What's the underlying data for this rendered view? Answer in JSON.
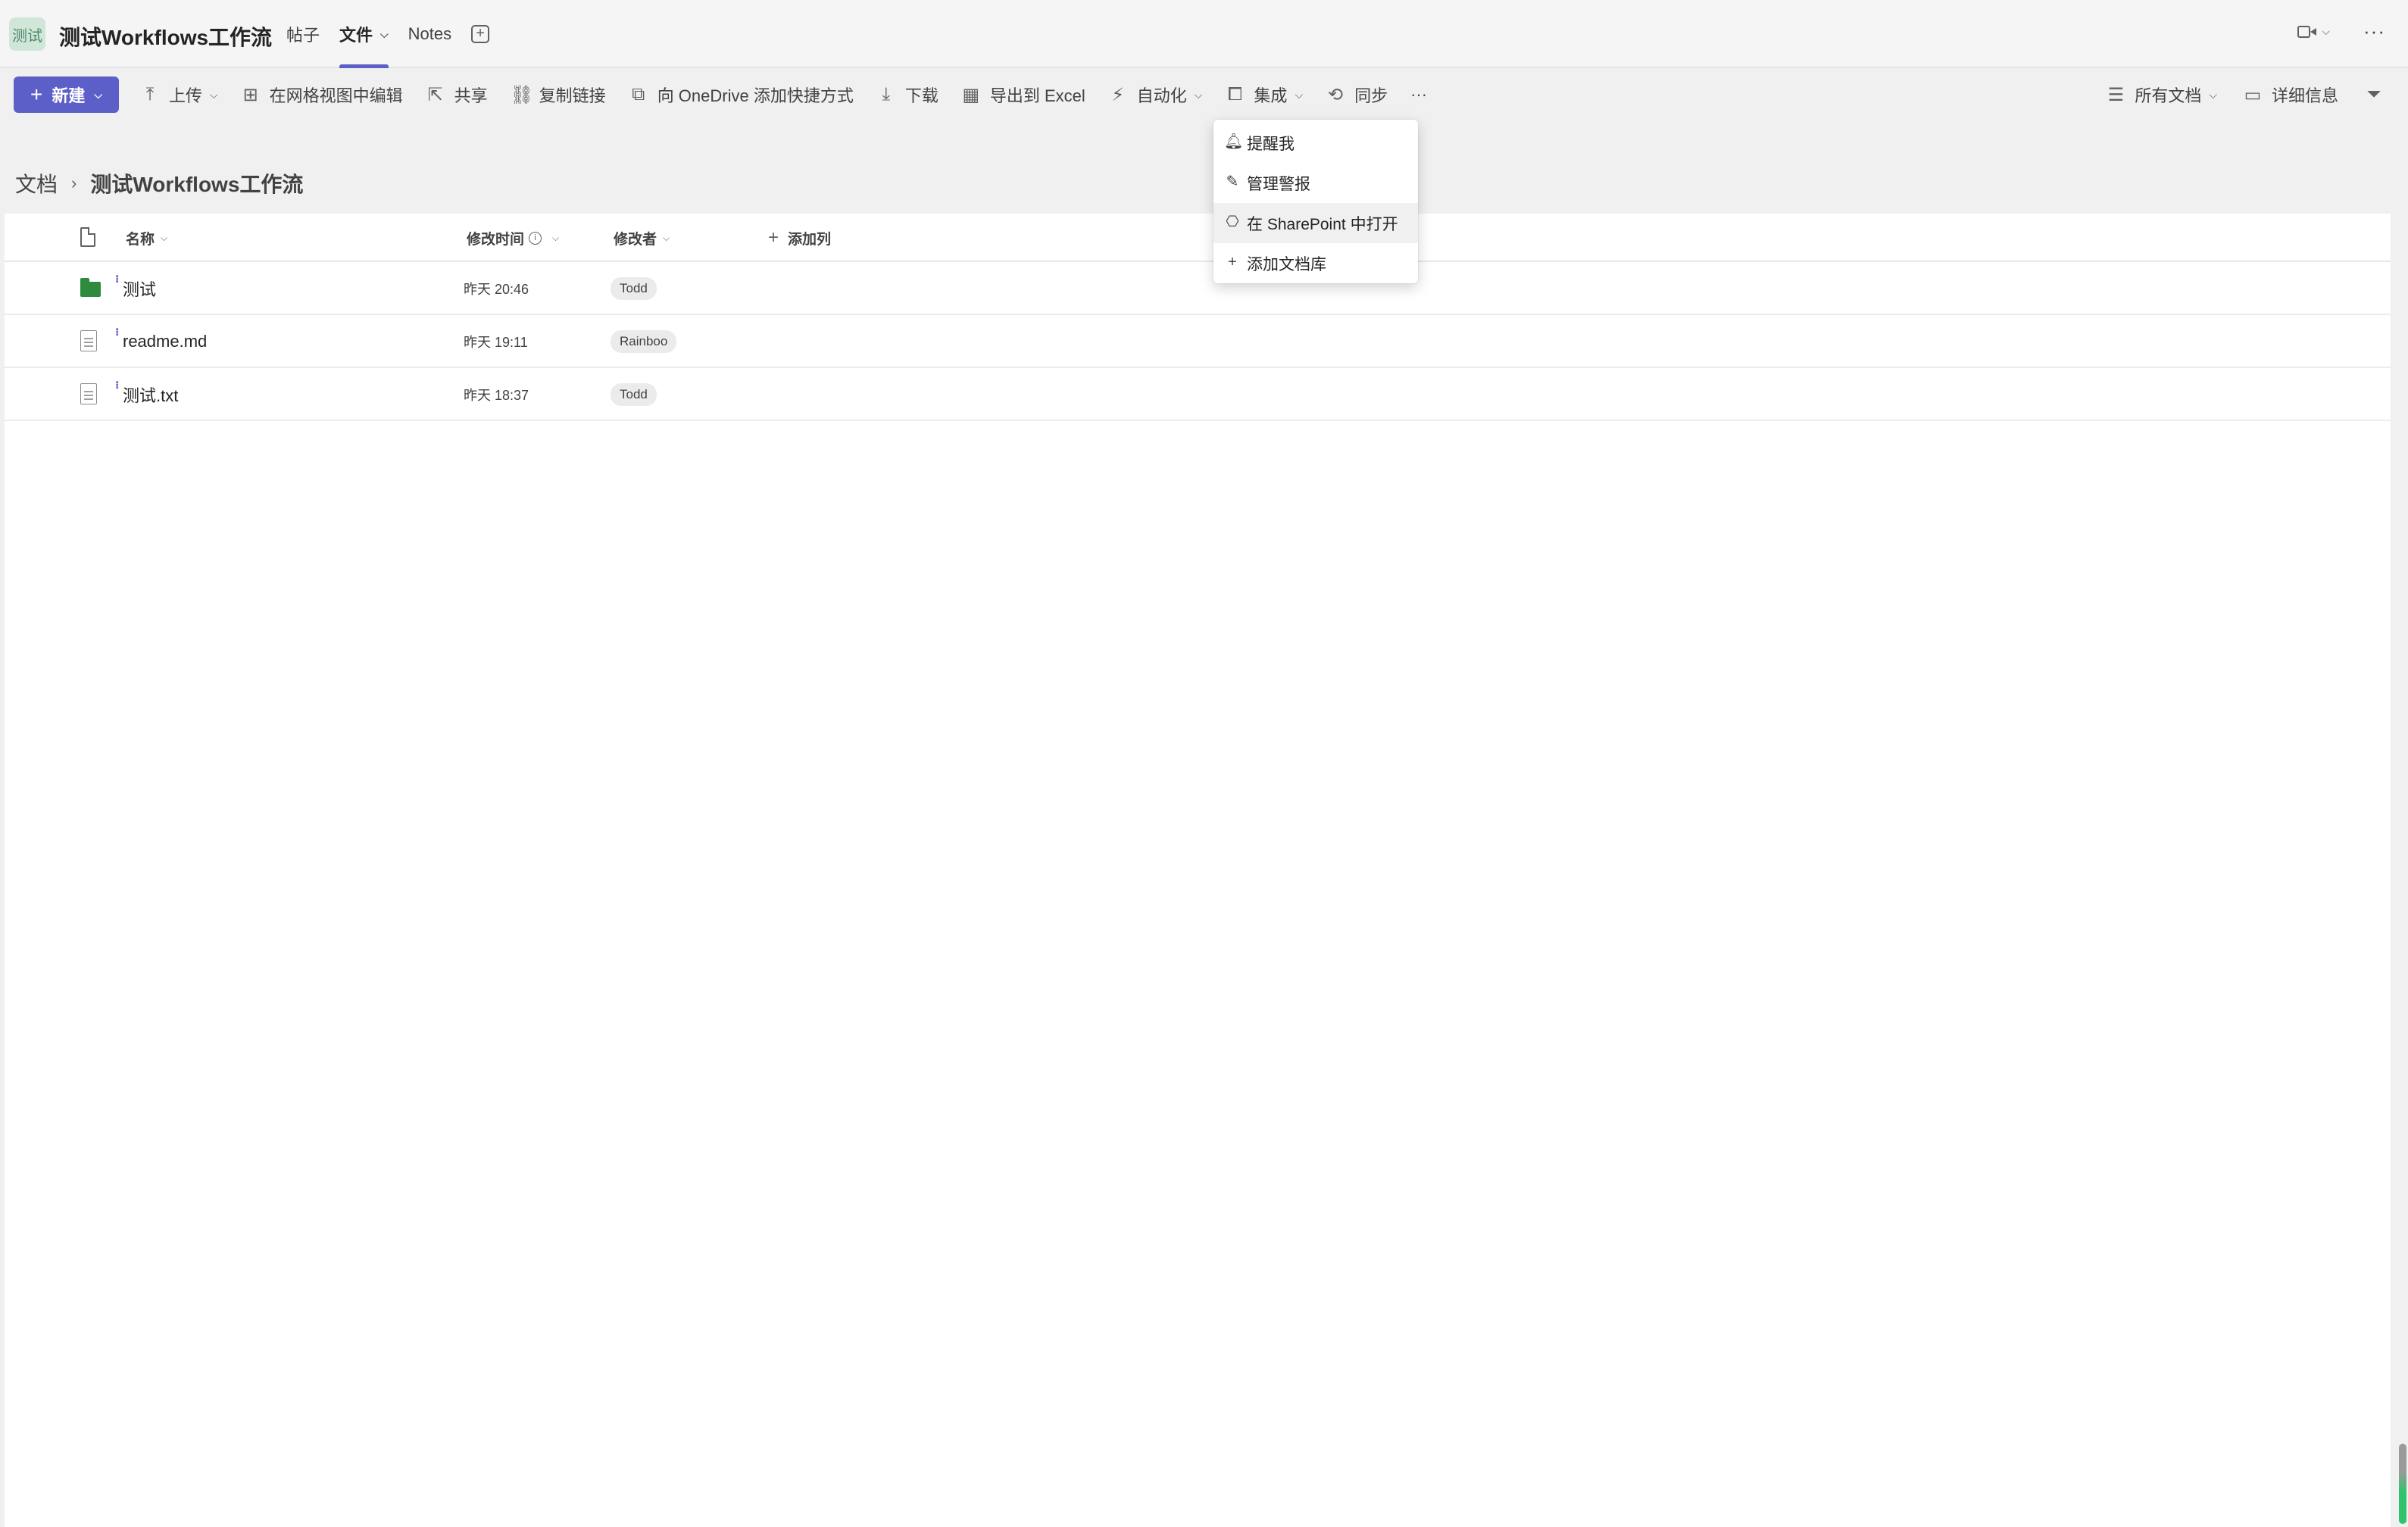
{
  "header": {
    "avatar_text": "测试",
    "title": "测试Workflows工作流",
    "tabs": [
      {
        "label": "帖子",
        "active": false
      },
      {
        "label": "文件",
        "active": true
      },
      {
        "label": "Notes",
        "active": false
      }
    ],
    "icons": [
      "add-tab-icon",
      "video-icon",
      "chevron-down-icon",
      "more-icon"
    ]
  },
  "toolbar": {
    "new_label": "新建",
    "upload_label": "上传",
    "grid_edit_label": "在网格视图中编辑",
    "share_label": "共享",
    "copy_link_label": "复制链接",
    "onedrive_label": "向 OneDrive 添加快捷方式",
    "download_label": "下载",
    "export_label": "导出到 Excel",
    "automate_label": "自动化",
    "integrate_label": "集成",
    "sync_label": "同步",
    "more_label": "···",
    "view_label": "所有文档",
    "details_label": "详细信息"
  },
  "breadcrumb": {
    "root": "文档",
    "current": "测试Workflows工作流"
  },
  "table": {
    "columns": {
      "name": "名称",
      "modified": "修改时间",
      "modified_by": "修改者",
      "add_column": "添加列"
    },
    "rows": [
      {
        "type": "folder",
        "name": "测试",
        "modified": "昨天 20:46",
        "modified_by": "Todd"
      },
      {
        "type": "file",
        "name": "readme.md",
        "modified": "昨天 19:11",
        "modified_by": "Rainboo"
      },
      {
        "type": "file",
        "name": "测试.txt",
        "modified": "昨天 18:37",
        "modified_by": "Todd"
      }
    ]
  },
  "menu": {
    "items": [
      {
        "label": "提醒我",
        "icon": "bell-icon"
      },
      {
        "label": "管理警报",
        "icon": "manage-alerts-icon"
      },
      {
        "label": "在 SharePoint 中打开",
        "icon": "sharepoint-icon",
        "hovered": true
      },
      {
        "label": "添加文档库",
        "icon": "plus-icon"
      }
    ]
  },
  "colors": {
    "accent": "#5b5fc7",
    "folder": "#2e8b3e",
    "background": "#f0f0f0"
  }
}
